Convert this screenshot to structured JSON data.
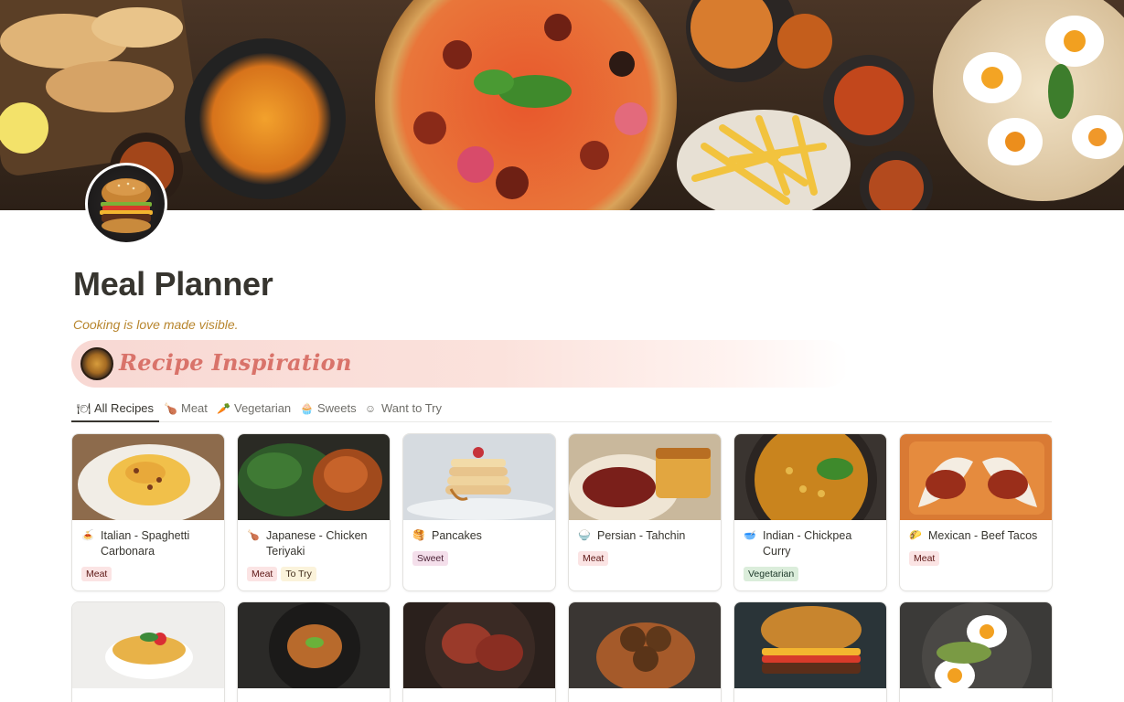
{
  "page": {
    "title": "Meal Planner",
    "quote": "Cooking is love made visible."
  },
  "callout": {
    "text": "Recipe Inspiration",
    "icon": "food-plate-icon"
  },
  "tabs": [
    {
      "label": "All Recipes",
      "icon": "fork-knife-icon",
      "active": true
    },
    {
      "label": "Meat",
      "icon": "drumstick-icon",
      "active": false
    },
    {
      "label": "Vegetarian",
      "icon": "carrot-icon",
      "active": false
    },
    {
      "label": "Sweets",
      "icon": "cupcake-icon",
      "active": false
    },
    {
      "label": "Want to Try",
      "icon": "smile-icon",
      "active": false
    }
  ],
  "recipes": [
    {
      "title": "Italian - Spaghetti Carbonara",
      "emoji": "🍝",
      "tags": [
        "Meat"
      ]
    },
    {
      "title": "Japanese - Chicken Teriyaki",
      "emoji": "🍗",
      "tags": [
        "Meat",
        "To Try"
      ]
    },
    {
      "title": "Pancakes",
      "emoji": "🥞",
      "tags": [
        "Sweet"
      ]
    },
    {
      "title": "Persian - Tahchin",
      "emoji": "🍚",
      "tags": [
        "Meat"
      ]
    },
    {
      "title": "Indian - Chickpea Curry",
      "emoji": "🥣",
      "tags": [
        "Vegetarian"
      ]
    },
    {
      "title": "Mexican - Beef Tacos",
      "emoji": "🌮",
      "tags": [
        "Meat"
      ]
    }
  ],
  "colors": {
    "accent_quote": "#b8862e",
    "callout_text": "#d9736a",
    "tag_meat": "#fbe4e4",
    "tag_try": "#fbf3db",
    "tag_sweet": "#f4dfeb",
    "tag_veg": "#dbeddb"
  }
}
